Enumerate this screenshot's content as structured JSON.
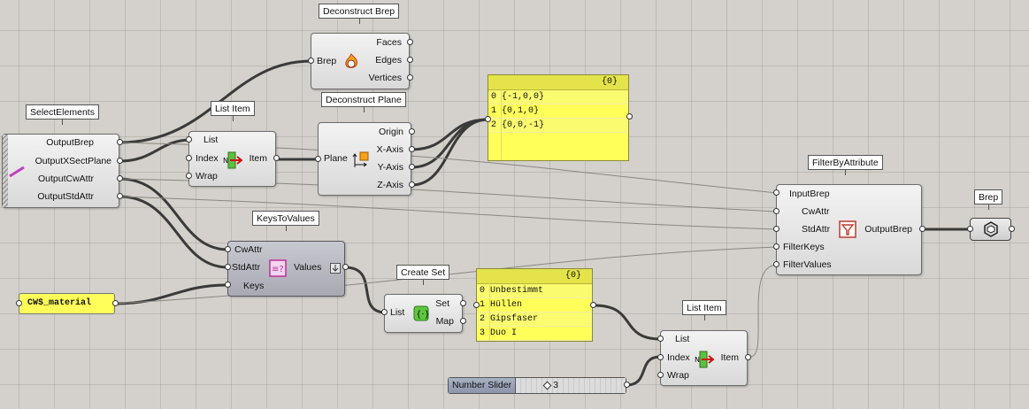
{
  "canvas": {
    "background": "#d4d0cb"
  },
  "components": {
    "deconstruct_brep": {
      "title": "Deconstruct Brep",
      "input": "Brep",
      "outputs": [
        "Faces",
        "Edges",
        "Vertices"
      ],
      "icon": "deconstruct-brep-icon"
    },
    "select_elements": {
      "title": "SelectElements",
      "outputs": [
        "OutputBrep",
        "OutputXSectPlane",
        "OutputCwAttr",
        "OutputStdAttr"
      ],
      "icon": "select-elements-icon"
    },
    "list_item_1": {
      "title": "List Item",
      "inputs": [
        "List",
        "Index",
        "Wrap"
      ],
      "output": "Item",
      "icon": "list-item-icon"
    },
    "deconstruct_plane": {
      "title": "Deconstruct Plane",
      "input": "Plane",
      "outputs": [
        "Origin",
        "X-Axis",
        "Y-Axis",
        "Z-Axis"
      ],
      "icon": "deconstruct-plane-icon"
    },
    "panel_axes": {
      "header": "{0}",
      "rows": [
        {
          "index": "0",
          "value": "{-1,0,0}"
        },
        {
          "index": "1",
          "value": "{0,1,0}"
        },
        {
          "index": "2",
          "value": "{0,0,-1}"
        }
      ],
      "color": "#ffff5a"
    },
    "filter_by_attribute": {
      "title": "FilterByAttribute",
      "inputs": [
        "InputBrep",
        "CwAttr",
        "StdAttr",
        "FilterKeys",
        "FilterValues"
      ],
      "output": "OutputBrep",
      "icon": "filter-icon"
    },
    "brep_param": {
      "title": "Brep",
      "icon": "brep-param-icon"
    },
    "keys_to_values": {
      "title": "KeysToValues",
      "inputs": [
        "CwAttr",
        "StdAttr",
        "Keys"
      ],
      "output": "Values",
      "icon": "keys-to-values-icon"
    },
    "cw_material": {
      "value": "CW$_material"
    },
    "create_set": {
      "title": "Create Set",
      "input": "List",
      "outputs": [
        "Set",
        "Map"
      ],
      "icon": "create-set-icon"
    },
    "panel_values": {
      "header": "{0}",
      "rows": [
        {
          "index": "0",
          "value": "Unbestimmt"
        },
        {
          "index": "1",
          "value": "Hüllen"
        },
        {
          "index": "2",
          "value": "Gipsfaser"
        },
        {
          "index": "3",
          "value": "Duo I"
        }
      ]
    },
    "list_item_2": {
      "title": "List Item",
      "inputs": [
        "List",
        "Index",
        "Wrap"
      ],
      "output": "Item",
      "icon": "list-item-icon"
    },
    "number_slider": {
      "name": "Number Slider",
      "value": "3"
    }
  }
}
